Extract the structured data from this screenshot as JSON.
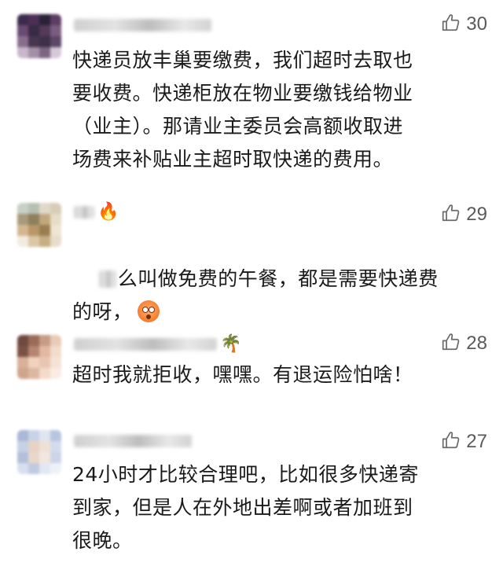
{
  "comments": [
    {
      "like_count": "30",
      "text": "快递员放丰巢要缴费，我们超时去取也\n要收费。快递柜放在物业要缴钱给物业\n（业主）。那请业主委员会高额收取进\n场费来补贴业主超时取快递的费用。",
      "avatar_colors": [
        "#3b2b4a",
        "#4d2f55",
        "#2a2238",
        "#5c3d63",
        "#6b4a72",
        "#372b45",
        "#523a58",
        "#7a5c80",
        "#8a6d8e",
        "#46364e",
        "#3e3048",
        "#5e4766",
        "#c9b7cb",
        "#a58fa8",
        "#7c6682",
        "#d6c8d8"
      ]
    },
    {
      "like_count": "29",
      "username_emoji": "🔥",
      "text_prefix": "么叫做免费的午餐，都是需要快递费\n的呀，",
      "avatar_colors": [
        "#c7d0c6",
        "#b6c0b2",
        "#e0d9c8",
        "#d8cdb6",
        "#a99a7b",
        "#8f7f5e",
        "#c2a77e",
        "#e7dcc5",
        "#d4b790",
        "#b89868",
        "#9b7d52",
        "#efe5d3",
        "#f2ece0",
        "#d9c7a6",
        "#c6ad84",
        "#e8ddc9"
      ]
    },
    {
      "like_count": "28",
      "username_emoji": "🌴",
      "text": "超时我就拒收，嘿嘿。有退运险怕啥！",
      "avatar_colors": [
        "#6e4a3e",
        "#9a6b58",
        "#c89c84",
        "#e9cbb8",
        "#7a5244",
        "#b58571",
        "#e2b8a0",
        "#f1dccd",
        "#d9b099",
        "#f0d2bf",
        "#e8c6b1",
        "#f5e3d6",
        "#cfa58e",
        "#dcb7a1",
        "#f3dbcb",
        "#faece2"
      ]
    },
    {
      "like_count": "27",
      "text": "24小时才比较合理吧，比如很多快递寄\n到家，但是人在外地出差啊或者加班到\n很晚。",
      "avatar_colors": [
        "#a9b9d6",
        "#c8d3e8",
        "#dfe5f1",
        "#b8c5de",
        "#c6d1e6",
        "#e7d2c4",
        "#f0e1d6",
        "#d3dcec",
        "#b3c0da",
        "#e9d7cb",
        "#f3e6dc",
        "#cbd5e8",
        "#d8e0ef",
        "#c0cbe1",
        "#e2e8f3",
        "#eef1f8"
      ]
    }
  ]
}
